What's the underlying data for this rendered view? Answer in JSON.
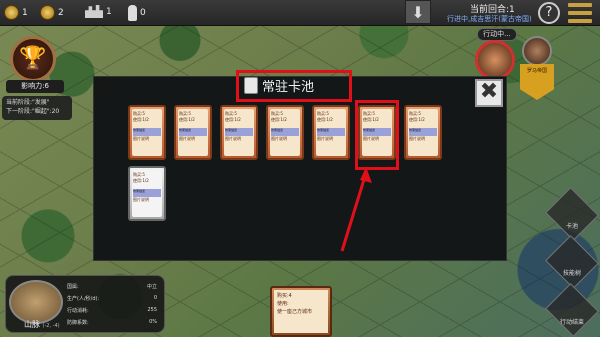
{
  "topbar": {
    "gold": "1",
    "gold_plus": "2",
    "buildings": "1",
    "soldiers": "0",
    "turn": "当前回合:1",
    "sub_turn": "行进中,成吉思汗(蒙古帝国)",
    "help": "?"
  },
  "left": {
    "influence": "影响力:6",
    "stage_line1": "当前阶段:\"发展\"",
    "stage_line2": "下一阶段:\"崛起\":20"
  },
  "right": {
    "acting": "行动中...",
    "avatar2_tag": "罗马帝国"
  },
  "panel": {
    "title": "常驻卡池",
    "close": "✖"
  },
  "cards": [
    {
      "l1": "购买:5",
      "l2": "使用:1/2",
      "l3": "效果描述",
      "l4": "图片说明"
    },
    {
      "l1": "购买:5",
      "l2": "使用:1/2",
      "l3": "效果描述",
      "l4": "图片说明"
    },
    {
      "l1": "购买:5",
      "l2": "使用:1/2",
      "l3": "效果描述",
      "l4": "图片说明"
    },
    {
      "l1": "购买:5",
      "l2": "使用:1/2",
      "l3": "效果描述",
      "l4": "图片说明"
    },
    {
      "l1": "购买:5",
      "l2": "使用:1/2",
      "l3": "效果描述",
      "l4": "图片说明"
    },
    {
      "l1": "购买:5",
      "l2": "使用:1/2",
      "l3": "效果描述",
      "l4": "图片说明"
    },
    {
      "l1": "购买:5",
      "l2": "使用:1/2",
      "l3": "效果描述",
      "l4": "图片说明"
    },
    {
      "l1": "购买:5",
      "l2": "使用:1/2",
      "l3": "效果描述",
      "l4": "图片说明"
    }
  ],
  "terrain": {
    "name": "山脉",
    "coord": "(-2, -4)",
    "rows": [
      {
        "k": "国属:",
        "v": "中立"
      },
      {
        "k": "生产(人/秒/d):",
        "v": "0"
      },
      {
        "k": "行动消耗:",
        "v": "255"
      },
      {
        "k": "防御系数:",
        "v": "0%"
      }
    ]
  },
  "small_card": {
    "buy": "购买:4",
    "use": "使用:",
    "desc": "使一座己方城市"
  },
  "side": {
    "b1": "卡池",
    "b2": "技能树",
    "b3": "行动结束"
  }
}
